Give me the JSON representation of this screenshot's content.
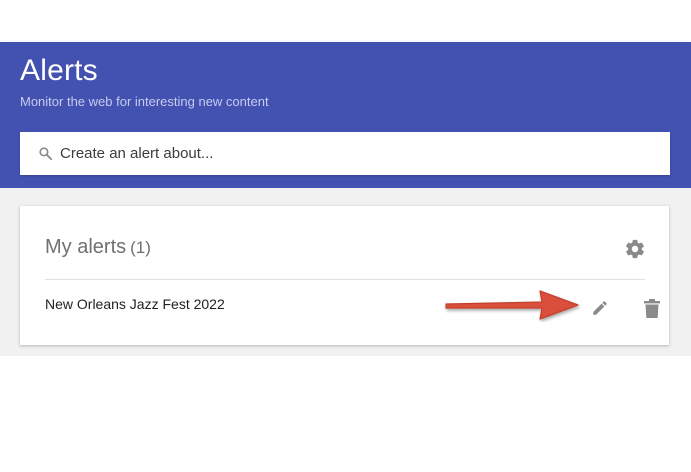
{
  "header": {
    "title": "Alerts",
    "subtitle": "Monitor the web for interesting new content",
    "background_color": "#4352b0"
  },
  "search": {
    "placeholder": "Create an alert about...",
    "icon": "search-icon"
  },
  "my_alerts": {
    "title": "My alerts",
    "count": "(1)",
    "settings_icon": "gear-icon",
    "items": [
      {
        "name": "New Orleans Jazz Fest 2022",
        "edit_icon": "pencil-icon",
        "delete_icon": "trash-icon"
      }
    ]
  },
  "annotation": {
    "arrow_color": "#d9503a",
    "points_to": "pencil-icon"
  }
}
